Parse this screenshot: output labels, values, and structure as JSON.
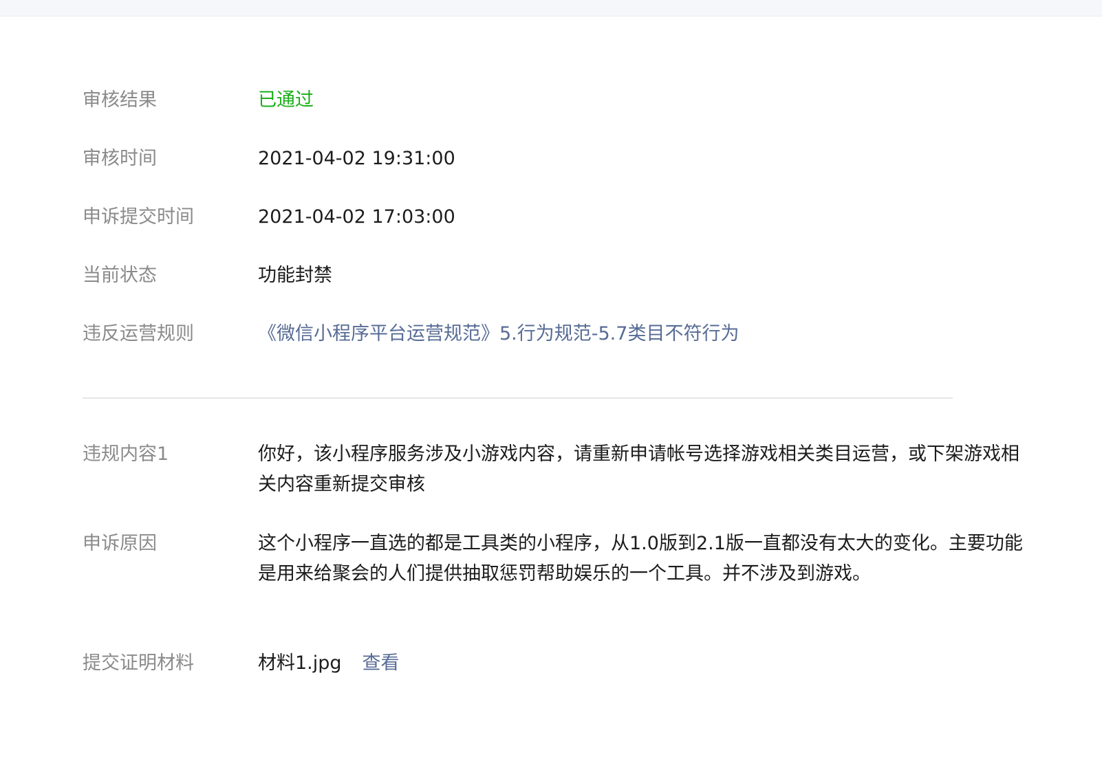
{
  "audit": {
    "result_label": "审核结果",
    "result_value": "已通过",
    "time_label": "审核时间",
    "time_value": "2021-04-02 19:31:00",
    "appeal_submit_label": "申诉提交时间",
    "appeal_submit_value": "2021-04-02 17:03:00",
    "current_status_label": "当前状态",
    "current_status_value": "功能封禁",
    "rule_label": "违反运营规则",
    "rule_value": "《微信小程序平台运营规范》5.行为规范-5.7类目不符行为"
  },
  "details": {
    "violation_label": "违规内容1",
    "violation_value": "你好，该小程序服务涉及小游戏内容，请重新申请帐号选择游戏相关类目运营，或下架游戏相关内容重新提交审核",
    "appeal_reason_label": "申诉原因",
    "appeal_reason_value": "这个小程序一直选的都是工具类的小程序，从1.0版到2.1版一直都没有太大的变化。主要功能是用来给聚会的人们提供抽取惩罚帮助娱乐的一个工具。并不涉及到游戏。",
    "evidence_label": "提交证明材料",
    "evidence_file": "材料1.jpg",
    "evidence_view": "查看"
  },
  "colors": {
    "pass_green": "#1aad19",
    "link_blue": "#576b95",
    "label_gray": "#8a8a8a",
    "text_dark": "#1c1c1c"
  }
}
